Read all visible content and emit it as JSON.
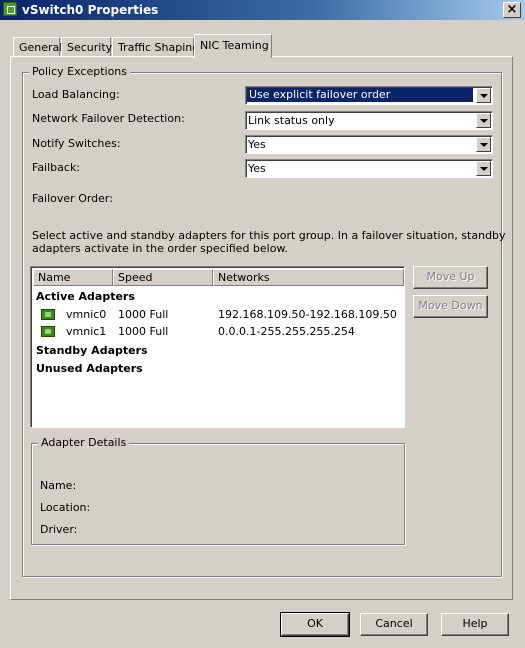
{
  "window": {
    "title": "vSwitch0 Properties",
    "close_glyph": "×"
  },
  "tabs": [
    {
      "label": "General"
    },
    {
      "label": "Security"
    },
    {
      "label": "Traffic Shaping"
    },
    {
      "label": "NIC Teaming",
      "active": true
    }
  ],
  "policy": {
    "legend": "Policy Exceptions",
    "load_balancing": {
      "label": "Load Balancing:",
      "value": "Use explicit failover order"
    },
    "failover_detection": {
      "label": "Network Failover Detection:",
      "value": "Link status only"
    },
    "notify_switches": {
      "label": "Notify Switches:",
      "value": "Yes"
    },
    "failback": {
      "label": "Failback:",
      "value": "Yes"
    },
    "failover_order_label": "Failover Order:",
    "description_line1": "Select active and standby adapters for this port group.  In a failover situation, standby",
    "description_line2": "adapters activate  in the order specified below."
  },
  "adapters": {
    "columns": [
      "Name",
      "Speed",
      "Networks"
    ],
    "active_header": "Active Adapters",
    "active": [
      {
        "name": "vmnic0",
        "speed": "1000 Full",
        "networks": "192.168.109.50-192.168.109.50"
      },
      {
        "name": "vmnic1",
        "speed": "1000 Full",
        "networks": "0.0.0.1-255.255.255.254"
      }
    ],
    "standby_header": "Standby Adapters",
    "unused_header": "Unused Adapters"
  },
  "buttons": {
    "move_up": "Move Up",
    "move_down": "Move Down",
    "ok": "OK",
    "cancel": "Cancel",
    "help": "Help"
  },
  "details": {
    "legend": "Adapter Details",
    "name_label": "Name:",
    "location_label": "Location:",
    "driver_label": "Driver:"
  },
  "colors": {
    "title_bar": "#0a246a",
    "selection": "#0a246a",
    "face": "#d4d0c8",
    "nic_icon": "#3a8a1a"
  },
  "icons": {
    "app": "vsphere-app-icon",
    "nic": "network-adapter-icon"
  }
}
